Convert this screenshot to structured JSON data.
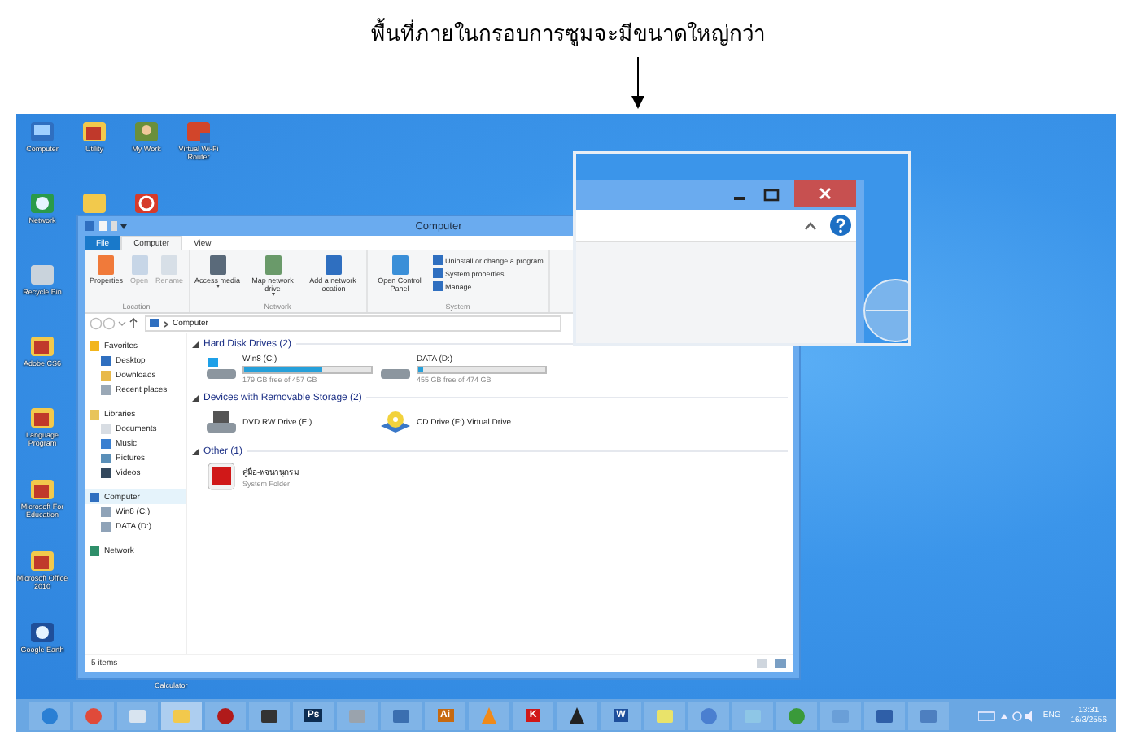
{
  "caption": "พื้นที่ภายในกรอบการซูมจะมีขนาดใหญ่กว่า",
  "desktop": {
    "left_column": [
      {
        "label": "Computer",
        "kind": "computer"
      },
      {
        "label": "Network",
        "kind": "globe"
      },
      {
        "label": "Recycle Bin",
        "kind": "recycle"
      },
      {
        "label": "Adobe CS6",
        "kind": "folder"
      },
      {
        "label": "Language Program",
        "kind": "folder"
      },
      {
        "label": "Microsoft For Education",
        "kind": "folder"
      },
      {
        "label": "Microsoft Office 2010",
        "kind": "folder"
      },
      {
        "label": "Google Earth",
        "kind": "earth"
      }
    ],
    "top_row": [
      {
        "label": "Utility",
        "kind": "folder"
      },
      {
        "label": "My Work",
        "kind": "people"
      },
      {
        "label": "Virtual Wi-Fi Router",
        "kind": "app"
      }
    ],
    "second_row": [
      {
        "kind": "folder"
      },
      {
        "kind": "power"
      }
    ],
    "hidden_icon_label": "Calculator"
  },
  "explorer": {
    "title": "Computer",
    "tabs": [
      {
        "label": "File",
        "kind": "file",
        "selected": false
      },
      {
        "label": "Computer",
        "kind": "tab",
        "selected": true
      },
      {
        "label": "View",
        "kind": "tab",
        "selected": false
      }
    ],
    "ribbon_groups": [
      {
        "name": "Location",
        "commands": [
          {
            "label": "Properties",
            "kind": "props",
            "disabled": false,
            "dropdown": false
          },
          {
            "label": "Open",
            "kind": "open",
            "disabled": true,
            "dropdown": false
          },
          {
            "label": "Rename",
            "kind": "rename",
            "disabled": true,
            "dropdown": false
          }
        ]
      },
      {
        "name": "Network",
        "commands": [
          {
            "label": "Access media",
            "kind": "media",
            "disabled": false,
            "dropdown": true
          },
          {
            "label": "Map network drive",
            "kind": "netdrive",
            "disabled": false,
            "dropdown": true
          },
          {
            "label": "Add a network location",
            "kind": "netloc",
            "disabled": false,
            "dropdown": false
          }
        ]
      },
      {
        "name": "System",
        "commands": [
          {
            "label": "Open Control Panel",
            "kind": "panel",
            "disabled": false,
            "dropdown": false
          }
        ],
        "small_commands": [
          "Uninstall or change a program",
          "System properties",
          "Manage"
        ]
      }
    ],
    "address": "Computer",
    "nav": [
      {
        "label": "Favorites",
        "kind": "star",
        "selected": false,
        "children": [
          {
            "label": "Desktop",
            "kind": "desktop",
            "selected": false
          },
          {
            "label": "Downloads",
            "kind": "download",
            "selected": false
          },
          {
            "label": "Recent places",
            "kind": "recent",
            "selected": false
          }
        ]
      },
      {
        "label": "Libraries",
        "kind": "library",
        "selected": false,
        "children": [
          {
            "label": "Documents",
            "kind": "doc",
            "selected": false
          },
          {
            "label": "Music",
            "kind": "music",
            "selected": false
          },
          {
            "label": "Pictures",
            "kind": "picture",
            "selected": false
          },
          {
            "label": "Videos",
            "kind": "video",
            "selected": false
          }
        ]
      },
      {
        "label": "Computer",
        "kind": "computer",
        "selected": true,
        "children": [
          {
            "label": "Win8 (C:)",
            "kind": "drive",
            "selected": false
          },
          {
            "label": "DATA (D:)",
            "kind": "drive",
            "selected": false
          }
        ]
      },
      {
        "label": "Network",
        "kind": "network",
        "selected": false
      }
    ],
    "groups": [
      {
        "title": "Hard Disk Drives (2)",
        "items": [
          {
            "kind": "windrive",
            "name": "Win8 (C:)",
            "detail": "179 GB free of 457 GB",
            "level": 0.61
          },
          {
            "kind": "drive",
            "name": "DATA (D:)",
            "detail": "455 GB free of 474 GB",
            "level": 0.04
          }
        ]
      },
      {
        "title": "Devices with Removable Storage (2)",
        "items": [
          {
            "kind": "dvd",
            "name": "DVD RW Drive (E:)"
          },
          {
            "kind": "cd",
            "name": "CD Drive (F:) Virtual Drive"
          }
        ]
      },
      {
        "title": "Other (1)",
        "items": [
          {
            "kind": "app",
            "name": "คู่มือ-พจนานุกรม",
            "detail": "System Folder"
          }
        ]
      }
    ],
    "status": "5 items"
  },
  "taskbar": {
    "items": [
      {
        "kind": "ie",
        "selected": false
      },
      {
        "kind": "chrome",
        "selected": false
      },
      {
        "kind": "feather",
        "selected": false
      },
      {
        "kind": "folder",
        "selected": true
      },
      {
        "kind": "red",
        "selected": false
      },
      {
        "kind": "audio",
        "selected": false
      },
      {
        "kind": "letter",
        "glyph": "Ps",
        "color": "#0d2d52",
        "selected": false
      },
      {
        "kind": "scanner",
        "selected": false
      },
      {
        "kind": "net",
        "selected": false
      },
      {
        "kind": "letter",
        "glyph": "Ai",
        "color": "#c76a10",
        "selected": false
      },
      {
        "kind": "cone",
        "selected": false
      },
      {
        "kind": "letter",
        "glyph": "K",
        "color": "#d01818",
        "selected": false
      },
      {
        "kind": "hourglass",
        "selected": false
      },
      {
        "kind": "letter",
        "glyph": "W",
        "color": "#1e4f9c",
        "selected": false
      },
      {
        "kind": "notes",
        "selected": false
      },
      {
        "kind": "music",
        "selected": false
      },
      {
        "kind": "glass",
        "selected": false
      },
      {
        "kind": "globe",
        "selected": false
      },
      {
        "kind": "remote",
        "selected": false
      },
      {
        "kind": "pc",
        "selected": false
      },
      {
        "kind": "pc2",
        "selected": false
      }
    ],
    "language": "ENG",
    "time": "13:31",
    "date": "16/3/2556"
  }
}
